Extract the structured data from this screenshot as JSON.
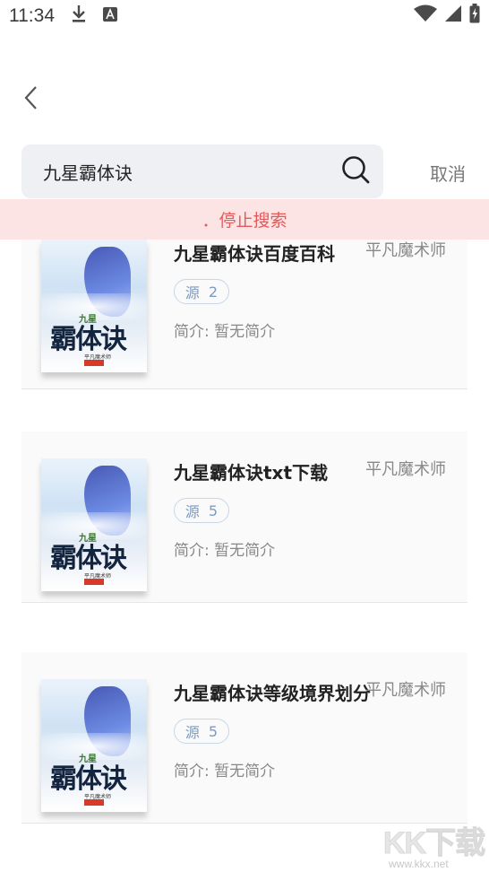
{
  "status_bar": {
    "time": "11:34",
    "icons": [
      "download-icon",
      "a-icon",
      "wifi-icon",
      "signal-icon",
      "battery-icon"
    ]
  },
  "search": {
    "query": "九星霸体诀",
    "cancel_label": "取消"
  },
  "banner": {
    "text": "．停止搜索"
  },
  "results": [
    {
      "title": "九星霸体诀百度百科",
      "author": "平凡魔术师",
      "source_label": "源",
      "source_count": "2",
      "intro": "简介: 暂无简介",
      "cover_title": "霸体诀",
      "cover_small": "九星",
      "cover_author": "平凡魔术师"
    },
    {
      "title": "九星霸体诀txt下载",
      "author": "平凡魔术师",
      "source_label": "源",
      "source_count": "5",
      "intro": "简介: 暂无简介",
      "cover_title": "霸体诀",
      "cover_small": "九星",
      "cover_author": "平凡魔术师"
    },
    {
      "title": "九星霸体诀等级境界划分",
      "author": "平凡魔术师",
      "source_label": "源",
      "source_count": "5",
      "intro": "简介: 暂无简介",
      "cover_title": "霸体诀",
      "cover_small": "九星",
      "cover_author": "平凡魔术师"
    }
  ],
  "watermark": {
    "logo": "KK下载",
    "url": "www.kkx.net"
  },
  "colors": {
    "banner_bg": "#fde4e4",
    "banner_text": "#e25a5a",
    "search_bg": "#eef0f3",
    "tag_border": "#c8d6e6",
    "tag_text": "#7d9bbd"
  }
}
